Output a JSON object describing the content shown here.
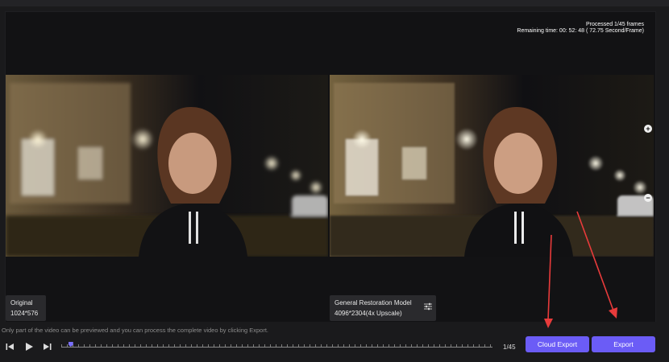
{
  "header": {
    "processed_text": "Processed 1/45 frames",
    "remaining_text": "Remaining time: 00: 52: 48 ( 72.75 Second/Frame)"
  },
  "original": {
    "title": "Original",
    "resolution": "1024*576"
  },
  "restored": {
    "model": "General Restoration Model",
    "resolution": "4096*2304(4x Upscale)"
  },
  "zoom": {
    "in_symbol": "+",
    "out_symbol": "−"
  },
  "footer": {
    "notice": "Only part of the video can be previewed and you can process the complete video by clicking Export.",
    "frame_counter": "1/45",
    "progress_fraction": 0.022,
    "cloud_export_label": "Cloud Export",
    "export_label": "Export"
  },
  "icons": {
    "prev": "skip-back-icon",
    "play": "play-icon",
    "next": "skip-forward-icon",
    "settings": "sliders-icon"
  },
  "colors": {
    "accent": "#6b5cf6",
    "annotation_arrow": "#e83b3b"
  }
}
